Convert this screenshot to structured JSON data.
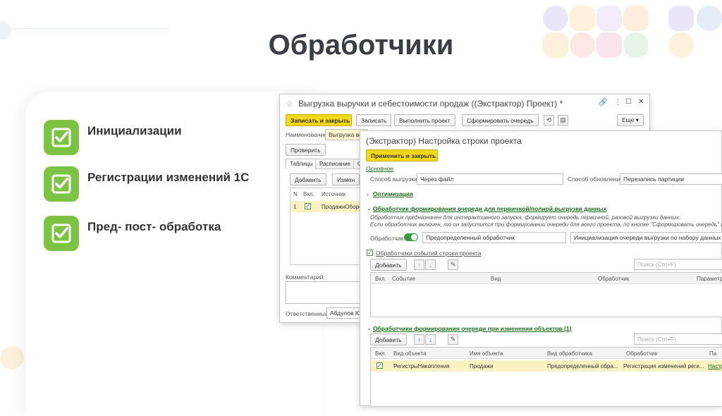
{
  "slide": {
    "title": "Обработчики",
    "items": [
      "Инициализации",
      "Регистрации изменений 1С",
      "Пред- пост- обработка"
    ]
  },
  "win1": {
    "title": "Выгрузка выручки и себестоимости продаж ((Экстрактор) Проект) *",
    "star": "☆",
    "controls": [
      "🔗",
      "⋮",
      "☐",
      "✕"
    ],
    "toolbar": {
      "save_close": "Записать и закрыть",
      "save": "Записать",
      "run": "Выполнить проект",
      "queue": "Сформировать очередь",
      "more": "Еще ▾"
    },
    "name_label": "Наименование:",
    "name_value": "Выгрузка выр",
    "check_button": "Проверить",
    "tabs": [
      "Таблицы",
      "Расписание",
      "С"
    ],
    "add_button": "Добавить",
    "edit_button": "Измен",
    "columns": [
      "N",
      "Вкл.",
      "Источник"
    ],
    "row": {
      "n": "1",
      "source": "ПродажиОборо"
    },
    "comment_label": "Комментарий:",
    "responsible_label": "Ответственный:",
    "responsible_value": "Абдулов Юр"
  },
  "win2": {
    "title": "(Экстрактор) Настройка строки проекта",
    "apply_close": "Применить и закрыть",
    "tab_main": "Основное",
    "unload_label": "Способ выгрузки:",
    "unload_value": "Через файл",
    "update_label": "Способ обновления:",
    "update_value": "Перезапись партиции",
    "optimization": "Оптимизация",
    "handler_group": "Обработчик формирования очереди для первичной/полной выгрузки данных",
    "note1": "Обработчик предназначен для интерактивного запуска, формирует очередь первичной, разовой выгрузки данных.",
    "note2": "Если обработчик включен, то он запустится при формировании очереди для всего проекта, по кнопке \"Сформировать очередь\" в шап",
    "handler_label": "Обработчик:",
    "handler_value": "Предопределенный обработчик",
    "handler_kind": "Инициализация очереди выгрузки по набору данных",
    "events_group": "Обработчики событий строки проекта",
    "add": "Добавить",
    "search": "Поиск (Ctrl+F)",
    "events_columns": [
      "Вкл.",
      "Событие",
      "Вид",
      "Обработчик",
      "Параметры"
    ],
    "changes_group": "Обработчики формирования очереди при изменении объектов (1)",
    "changes_columns": [
      "Вкл.",
      "Вид объекта",
      "Имя объекта",
      "Вид обработчика",
      "Обработчик",
      "Па"
    ],
    "changes_row": {
      "kind": "РегистрыНакопления",
      "name": "Продажи",
      "handler_kind": "Предопределенный обра...",
      "handler": "Регистрация изменений реги...",
      "params": "Настр"
    }
  }
}
